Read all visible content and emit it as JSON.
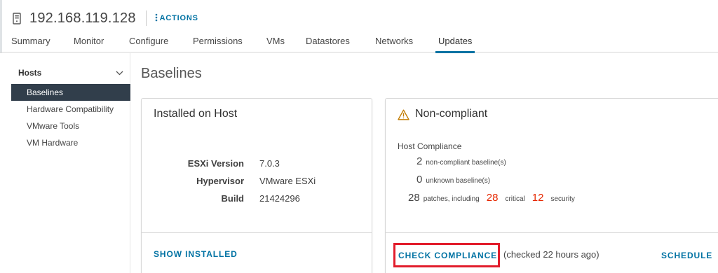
{
  "header": {
    "host_icon": "server-icon",
    "title": "192.168.119.128",
    "actions_label": "ACTIONS",
    "actions_icon": "vertical-dots-icon"
  },
  "tabs": [
    {
      "label": "Summary"
    },
    {
      "label": "Monitor"
    },
    {
      "label": "Configure"
    },
    {
      "label": "Permissions"
    },
    {
      "label": "VMs"
    },
    {
      "label": "Datastores"
    },
    {
      "label": "Networks"
    },
    {
      "label": "Updates",
      "active": true
    }
  ],
  "sidebar": {
    "group_label": "Hosts",
    "group_icon": "chevron-down-icon",
    "items": [
      {
        "label": "Baselines",
        "active": true
      },
      {
        "label": "Hardware Compatibility"
      },
      {
        "label": "VMware Tools"
      },
      {
        "label": "VM Hardware"
      }
    ]
  },
  "main": {
    "title": "Baselines",
    "installed": {
      "title": "Installed on Host",
      "rows": [
        {
          "label": "ESXi Version",
          "value": "7.0.3"
        },
        {
          "label": "Hypervisor",
          "value": "VMware ESXi"
        },
        {
          "label": "Build",
          "value": "21424296"
        }
      ],
      "show_installed_label": "SHOW INSTALLED"
    },
    "compliance": {
      "status_icon": "warning-icon",
      "title": "Non-compliant",
      "host_compliance_label": "Host Compliance",
      "noncompliant_count": "2",
      "noncompliant_text": "non-compliant baseline(s)",
      "unknown_count": "0",
      "unknown_text": "unknown baseline(s)",
      "patches_count": "28",
      "patches_text": "patches, including",
      "critical_count": "28",
      "critical_text": "critical",
      "security_count": "12",
      "security_text": "security",
      "check_compliance_label": "CHECK COMPLIANCE",
      "checked_text": "(checked 22 hours ago)",
      "schedule_label": "SCHEDULE"
    }
  },
  "colors": {
    "accent": "#0072a3",
    "sidebar_active": "#313e4b",
    "critical_red": "#e62700",
    "warning": "#c27b00",
    "highlight_box": "#e21d2c"
  }
}
